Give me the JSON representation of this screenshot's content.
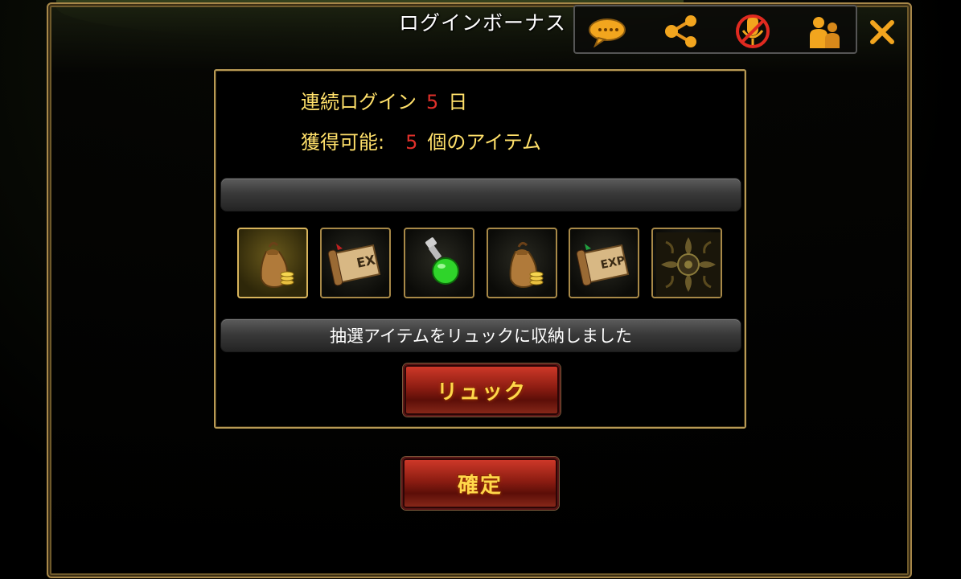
{
  "dialog": {
    "title": "ログインボーナス"
  },
  "toolbar": {
    "icons": [
      "chat-icon",
      "share-icon",
      "mute-icon",
      "friends-icon",
      "close-icon"
    ]
  },
  "bonus": {
    "consecutive_label": "連続ログイン",
    "consecutive_days": "5",
    "day_unit": "日",
    "obtainable_label": "獲得可能:",
    "obtainable_count": "5",
    "obtainable_unit": "個のアイテム"
  },
  "items": [
    {
      "icon": "gold-bag-icon",
      "selected": true
    },
    {
      "icon": "exp-scroll-icon",
      "selected": false
    },
    {
      "icon": "green-potion-icon",
      "selected": false
    },
    {
      "icon": "gold-bag-icon",
      "selected": false
    },
    {
      "icon": "exp-scroll-icon",
      "selected": false
    },
    {
      "icon": "locked-seal-icon",
      "selected": false
    }
  ],
  "message": "抽選アイテムをリュックに収納しました",
  "buttons": {
    "backpack": "リュック",
    "confirm": "確定"
  },
  "colors": {
    "accent_gold": "#ffe06a",
    "highlight_red": "#e0302a",
    "frame_gold": "#b89a55"
  }
}
